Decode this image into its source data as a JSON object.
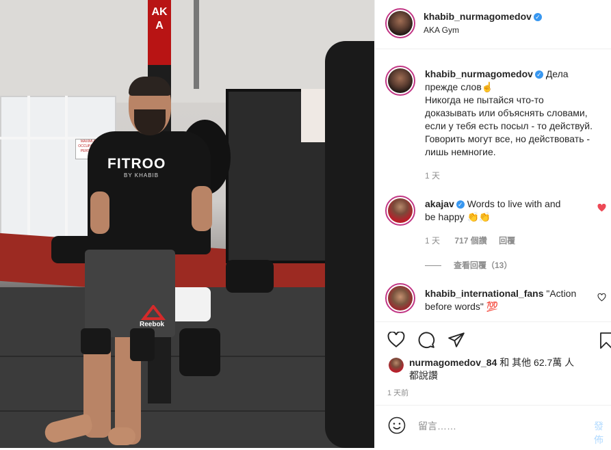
{
  "post": {
    "author": "khabib_nurmagomedov",
    "location": "AKA Gym",
    "verified_mark": "✓",
    "caption_lines": [
      "Дела",
      "прежде слов☝",
      "Никогда не пытайся что-то",
      "доказывать или объяснять словами,",
      "если у тебя есть посыл - то действуй.",
      "Говорить могут все, но действовать -",
      "лишь немногие."
    ],
    "caption_time": "1 天"
  },
  "comments": [
    {
      "user": "akajav",
      "verified": true,
      "lines": [
        "Words to live with and",
        "be happy 👏👏"
      ],
      "time": "1 天",
      "likes": "717 個讚",
      "reply": "回覆",
      "view_replies": "查看回覆（13）",
      "liked": true
    },
    {
      "user": "khabib_international_fans",
      "verified": false,
      "lines": [
        "\"Action",
        "before words\" 💯"
      ]
    }
  ],
  "likes_summary": {
    "user": "nurmagomedov_84",
    "rest_line1": "和 其他 62.7萬 人",
    "rest_line2": "都說讚"
  },
  "post_time": "1 天前",
  "add_comment": {
    "placeholder": "留言……",
    "post_label": "發佈"
  },
  "photo": {
    "sign_text": "MAXIMUM OCCUPANCY PERSONS",
    "shirt_brand": "FITROO",
    "shirt_sub": "BY KHABIB",
    "shorts_brand": "Reebok",
    "pole_text": "AKA"
  },
  "colors": {
    "verified": "#3897f0",
    "heart": "#ed4956",
    "story_ring": "#c13584",
    "muted": "#8e8e8e"
  },
  "icons": [
    "heart-icon",
    "comment-icon",
    "share-icon",
    "bookmark-icon",
    "emoji-icon",
    "verified-icon"
  ]
}
